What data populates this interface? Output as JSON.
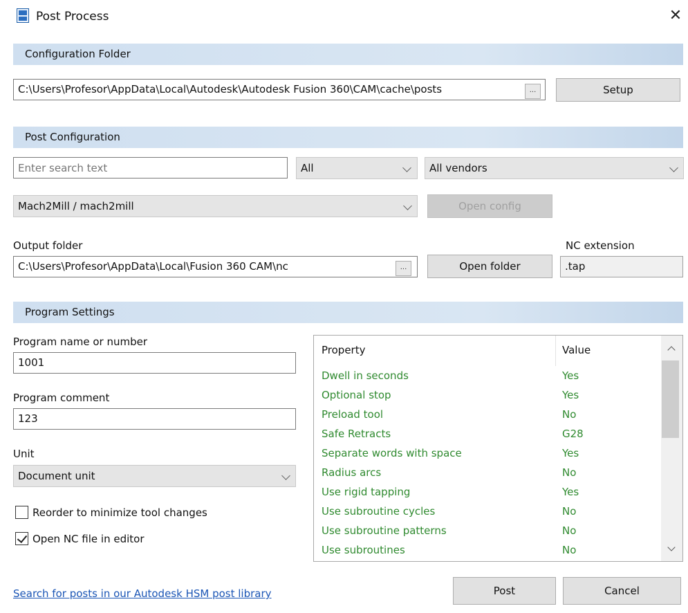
{
  "window": {
    "title": "Post Process",
    "close_glyph": "✕",
    "app_icon": "g1g2-icon"
  },
  "config_folder": {
    "header": "Configuration Folder",
    "path": "C:\\Users\\Profesor\\AppData\\Local\\Autodesk\\Autodesk Fusion 360\\CAM\\cache\\posts",
    "browse": "...",
    "setup_label": "Setup"
  },
  "post_config": {
    "header": "Post Configuration",
    "search_placeholder": "Enter search text",
    "filter_selected": "All",
    "vendor_selected": "All vendors",
    "post_selected": "Mach2Mill / mach2mill",
    "open_config_label": "Open config",
    "output_folder_label": "Output folder",
    "output_folder": "C:\\Users\\Profesor\\AppData\\Local\\Fusion 360 CAM\\nc",
    "browse": "...",
    "open_folder_label": "Open folder",
    "nc_extension_label": "NC extension",
    "nc_extension": ".tap"
  },
  "program_settings": {
    "header": "Program Settings",
    "program_name_label": "Program name or number",
    "program_name": "1001",
    "program_comment_label": "Program comment",
    "program_comment": "123",
    "unit_label": "Unit",
    "unit_selected": "Document unit",
    "reorder_label": "Reorder to minimize tool changes",
    "reorder_checked": false,
    "open_nc_label": "Open NC file in editor",
    "open_nc_checked": true
  },
  "properties": {
    "columns": [
      "Property",
      "Value"
    ],
    "rows": [
      {
        "property": "Dwell in seconds",
        "value": "Yes"
      },
      {
        "property": "Optional stop",
        "value": "Yes"
      },
      {
        "property": "Preload tool",
        "value": "No"
      },
      {
        "property": "Safe Retracts",
        "value": "G28"
      },
      {
        "property": "Separate words with space",
        "value": "Yes"
      },
      {
        "property": "Radius arcs",
        "value": "No"
      },
      {
        "property": "Use rigid tapping",
        "value": "Yes"
      },
      {
        "property": "Use subroutine cycles",
        "value": "No"
      },
      {
        "property": "Use subroutine patterns",
        "value": "No"
      },
      {
        "property": "Use subroutines",
        "value": "No"
      }
    ],
    "modified_color": "#2f8a2f"
  },
  "footer": {
    "library_link": "Search for posts in our Autodesk HSM post library",
    "post_label": "Post",
    "cancel_label": "Cancel"
  },
  "colors": {
    "section_header": "#d3e2f1",
    "link": "#1a55b5",
    "accent": "#0078d7"
  }
}
